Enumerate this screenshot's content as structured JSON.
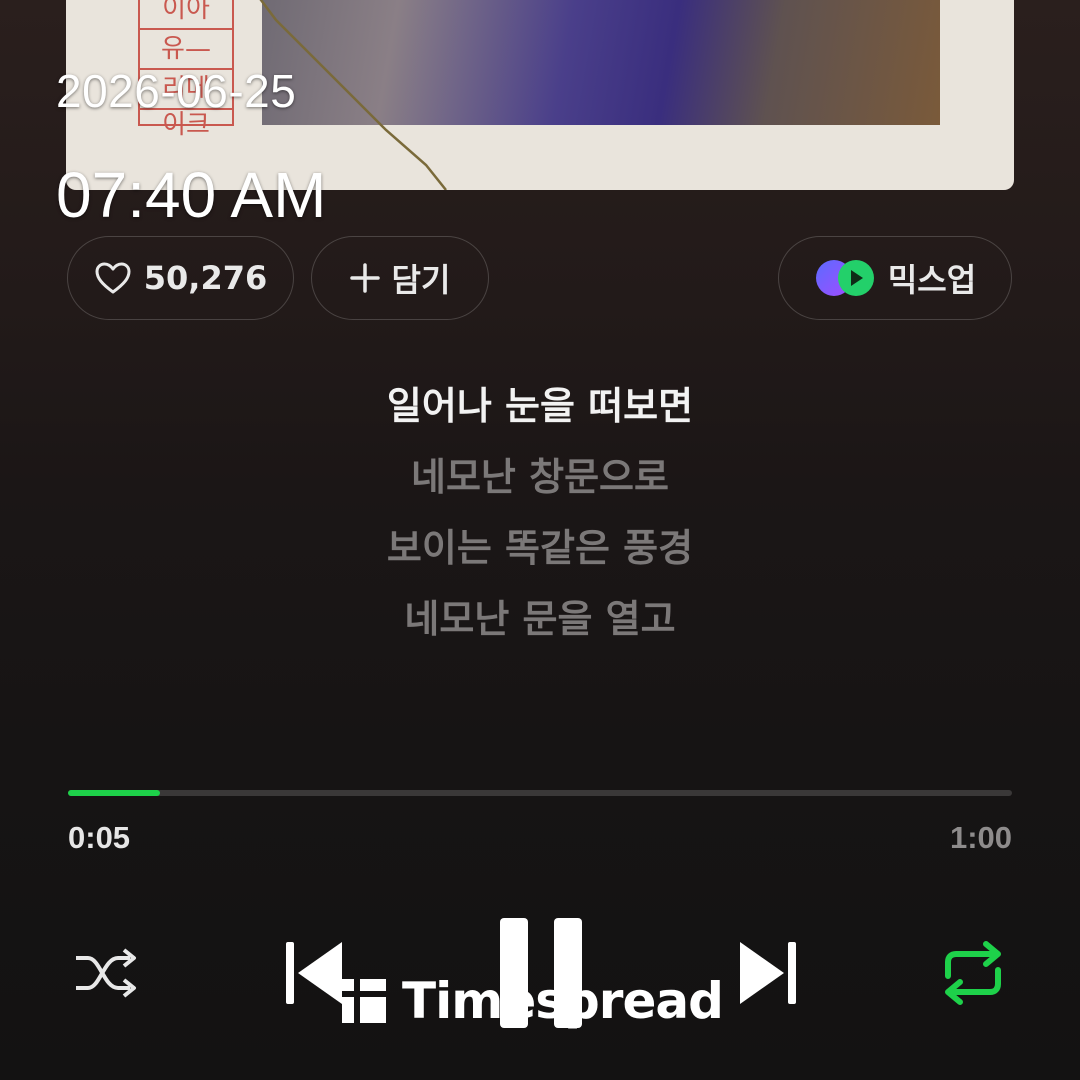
{
  "status": {
    "date": "2026-06-25",
    "time": "07:40 AM"
  },
  "album_art": {
    "stamp_lines": [
      "이아",
      "유—",
      "리메",
      "이크"
    ]
  },
  "actions": {
    "like_count": "50,276",
    "add_label": "담기",
    "mixup_label": "믹스업"
  },
  "lyrics": {
    "lines": [
      {
        "text": "일어나 눈을 떠보면",
        "active": true
      },
      {
        "text": "네모난 창문으로",
        "active": false
      },
      {
        "text": "보이는 똑같은 풍경",
        "active": false
      },
      {
        "text": "네모난 문을 열고",
        "active": false
      }
    ]
  },
  "player": {
    "current_time": "0:05",
    "total_time": "1:00",
    "progress": 0.0975,
    "shuffle_icon": "shuffle-icon",
    "prev_icon": "skip-previous-icon",
    "play_state_icon": "pause-icon",
    "next_icon": "skip-next-icon",
    "repeat_icon": "repeat-icon",
    "accent_color": "#1ed14a"
  },
  "watermark": {
    "text": "Timespread"
  }
}
